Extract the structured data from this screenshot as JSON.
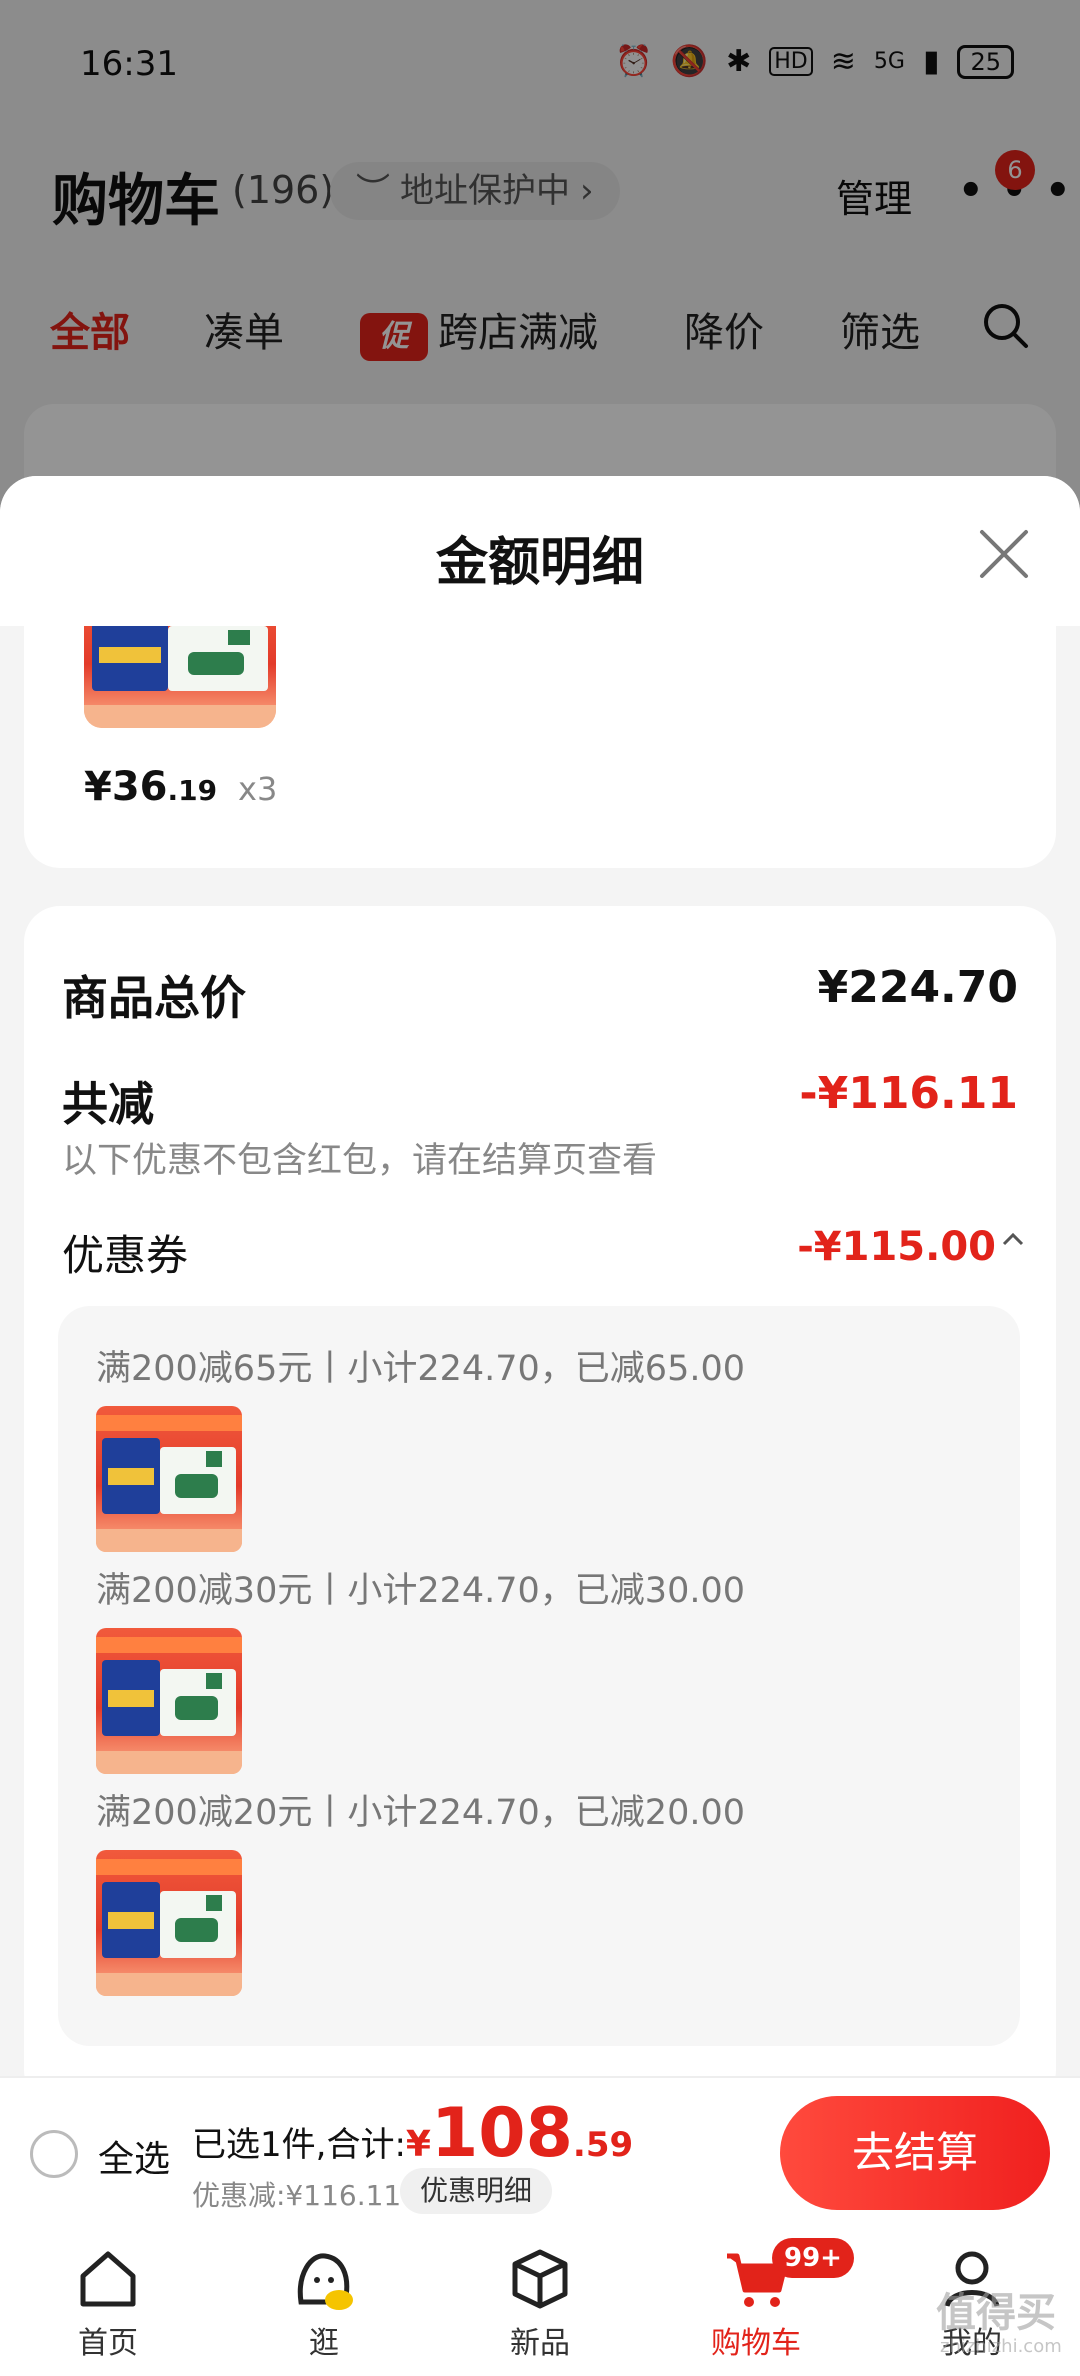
{
  "status_bar": {
    "time": "16:31",
    "network": "5G",
    "hd": "HD",
    "battery": "25"
  },
  "cart_header": {
    "title": "购物车",
    "count": "(196)",
    "address_protect": "地址保护中",
    "manage": "管理",
    "more_badge": "6"
  },
  "filters": [
    {
      "label": "全部",
      "active": true
    },
    {
      "label": "凑单"
    },
    {
      "label": "跨店满减",
      "tag": "促"
    },
    {
      "label": "降价"
    },
    {
      "label": "筛选"
    }
  ],
  "sheet": {
    "title": "金额明细",
    "product": {
      "price_yuan": "¥36",
      "price_cents": ".19",
      "qty": "x3"
    },
    "summary": {
      "total_label": "商品总价",
      "total_value": "¥224.70",
      "reduce_label": "共减",
      "reduce_value": "-¥116.11",
      "note": "以下优惠不包含红包，请在结算页查看",
      "coupon_label": "优惠券",
      "coupon_value": "-¥115.00"
    },
    "coupons": [
      {
        "text": "满200减65元丨小计224.70，已减65.00"
      },
      {
        "text": "满200减30元丨小计224.70，已减30.00"
      },
      {
        "text": "满200减20元丨小计224.70，已减20.00"
      }
    ]
  },
  "checkout": {
    "select_all": "全选",
    "selected_prefix": "已选1件,合计:",
    "yen": "¥",
    "total_int": "108",
    "total_dec": ".59",
    "discount": "优惠减:¥116.11",
    "detail_btn": "优惠明细",
    "checkout_btn": "去结算"
  },
  "tabs": [
    {
      "label": "首页"
    },
    {
      "label": "逛"
    },
    {
      "label": "新品"
    },
    {
      "label": "购物车",
      "badge": "99+",
      "active": true
    },
    {
      "label": "我的"
    }
  ],
  "watermark": {
    "text": "值得买",
    "url": "zhizhizhi.com"
  },
  "colors": {
    "accent": "#e2231a",
    "sheet_bg": "#f4f4f4",
    "dim": "rgba(0,0,0,0.42)"
  }
}
